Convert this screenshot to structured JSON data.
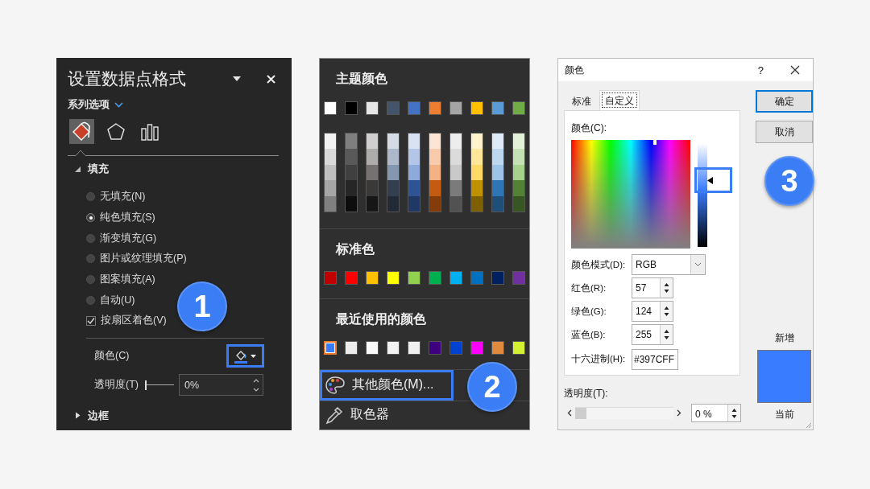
{
  "format_pane": {
    "title": "设置数据点格式",
    "options_menu": "系列选项",
    "icon_tabs": [
      {
        "kind": "fill",
        "selected": true
      },
      {
        "kind": "effects",
        "selected": false
      },
      {
        "kind": "series",
        "selected": false
      }
    ],
    "fill": {
      "label": "填充",
      "expanded": true,
      "options": [
        {
          "kind": "radio",
          "label": "无填充(N)",
          "selected": false
        },
        {
          "kind": "radio",
          "label": "纯色填充(S)",
          "selected": true
        },
        {
          "kind": "radio",
          "label": "渐变填充(G)",
          "selected": false
        },
        {
          "kind": "radio",
          "label": "图片或纹理填充(P)",
          "selected": false
        },
        {
          "kind": "radio",
          "label": "图案填充(A)",
          "selected": false
        },
        {
          "kind": "radio",
          "label": "自动(U)",
          "selected": false
        },
        {
          "kind": "checkbox",
          "label": "按扇区着色(V)",
          "checked": true
        }
      ],
      "color": {
        "label": "颜色(C)",
        "highlighted": true
      },
      "transparency": {
        "label": "透明度(T)",
        "level": 0,
        "value": "0%"
      }
    },
    "border": {
      "label": "边框",
      "expanded": false
    },
    "callout": "1"
  },
  "color_menu": {
    "theme_title": "主题颜色",
    "theme_colors": [
      {
        "color": "#ffffff",
        "shades": [
          {
            "color": "#f2f2f2"
          },
          {
            "color": "#d9d9d9"
          },
          {
            "color": "#bfbfbf"
          },
          {
            "color": "#a6a6a6"
          },
          {
            "color": "#808080"
          }
        ]
      },
      {
        "color": "#000000",
        "shades": [
          {
            "color": "#7f7f7f"
          },
          {
            "color": "#595959"
          },
          {
            "color": "#404040"
          },
          {
            "color": "#262626"
          },
          {
            "color": "#0d0d0d"
          }
        ]
      },
      {
        "color": "#e7e6e6",
        "shades": [
          {
            "color": "#d0cece"
          },
          {
            "color": "#aeabab"
          },
          {
            "color": "#757171"
          },
          {
            "color": "#3b3838"
          },
          {
            "color": "#171616"
          }
        ]
      },
      {
        "color": "#44546a",
        "shades": [
          {
            "color": "#d6dce4"
          },
          {
            "color": "#adb9ca"
          },
          {
            "color": "#8497b0"
          },
          {
            "color": "#333f4f"
          },
          {
            "color": "#222a35"
          }
        ]
      },
      {
        "color": "#4472c4",
        "shades": [
          {
            "color": "#d9e2f3"
          },
          {
            "color": "#b4c6e7"
          },
          {
            "color": "#8eaadb"
          },
          {
            "color": "#2f5496"
          },
          {
            "color": "#1f3864"
          }
        ]
      },
      {
        "color": "#ed7d31",
        "shades": [
          {
            "color": "#fbe5d5"
          },
          {
            "color": "#f7cbac"
          },
          {
            "color": "#f4b183"
          },
          {
            "color": "#c55a11"
          },
          {
            "color": "#843c0b"
          }
        ]
      },
      {
        "color": "#a5a5a5",
        "shades": [
          {
            "color": "#ededed"
          },
          {
            "color": "#dbdbdb"
          },
          {
            "color": "#c9c9c9"
          },
          {
            "color": "#7b7b7b"
          },
          {
            "color": "#525252"
          }
        ]
      },
      {
        "color": "#ffc000",
        "shades": [
          {
            "color": "#fff2cc"
          },
          {
            "color": "#ffe699"
          },
          {
            "color": "#ffd966"
          },
          {
            "color": "#bf9000"
          },
          {
            "color": "#7f6000"
          }
        ]
      },
      {
        "color": "#5b9bd5",
        "shades": [
          {
            "color": "#deebf6"
          },
          {
            "color": "#bdd7ee"
          },
          {
            "color": "#9dc3e6"
          },
          {
            "color": "#2e75b5"
          },
          {
            "color": "#1f4e79"
          }
        ]
      },
      {
        "color": "#70ad47",
        "shades": [
          {
            "color": "#e2efd9"
          },
          {
            "color": "#c5e0b3"
          },
          {
            "color": "#a8d08d"
          },
          {
            "color": "#538135"
          },
          {
            "color": "#375623"
          }
        ]
      }
    ],
    "standard_title": "标准色",
    "standard_colors": [
      {
        "color": "#c00000"
      },
      {
        "color": "#ff0000"
      },
      {
        "color": "#ffc000"
      },
      {
        "color": "#ffff00"
      },
      {
        "color": "#92d050"
      },
      {
        "color": "#00b050"
      },
      {
        "color": "#00b0f0"
      },
      {
        "color": "#0070c0"
      },
      {
        "color": "#002060"
      },
      {
        "color": "#7030a0"
      }
    ],
    "recent_title": "最近使用的颜色",
    "recent_colors": [
      {
        "color": "#3a7cff",
        "selected": true
      },
      {
        "color": "#ececec",
        "selected": false
      },
      {
        "color": "#fafafa",
        "selected": false
      },
      {
        "color": "#f2f2f2",
        "selected": false
      },
      {
        "color": "#efefef",
        "selected": false
      },
      {
        "color": "#3f0080",
        "selected": false
      },
      {
        "color": "#0041d0",
        "selected": false
      },
      {
        "color": "#ff00ff",
        "selected": false
      },
      {
        "color": "#e08a40",
        "selected": false
      },
      {
        "color": "#d4f032",
        "selected": false
      }
    ],
    "more_colors": {
      "label": "其他颜色(M)...",
      "highlighted": true
    },
    "eyedropper": "取色器",
    "callout": "2"
  },
  "color_dialog": {
    "title": "颜色",
    "help": "?",
    "tabs": [
      {
        "label": "标准",
        "selected": false
      },
      {
        "label": "自定义",
        "selected": true
      }
    ],
    "color_label": "颜色(C):",
    "luminance": {
      "level": 0.61,
      "highlighted": true
    },
    "color_model": {
      "label": "颜色模式(D):",
      "value": "RGB"
    },
    "channels": [
      {
        "label": "红色(R):",
        "value": "57"
      },
      {
        "label": "绿色(G):",
        "value": "124"
      },
      {
        "label": "蓝色(B):",
        "value": "255"
      }
    ],
    "hex": {
      "label": "十六进制(H):",
      "value": "#397CFF"
    },
    "transparency": {
      "label": "透明度(T):",
      "level": 0,
      "value": "0 %"
    },
    "buttons": [
      {
        "label": "确定",
        "default": true
      },
      {
        "label": "取消",
        "default": false
      }
    ],
    "new_label": "新增",
    "current_label": "当前",
    "callout": "3"
  }
}
